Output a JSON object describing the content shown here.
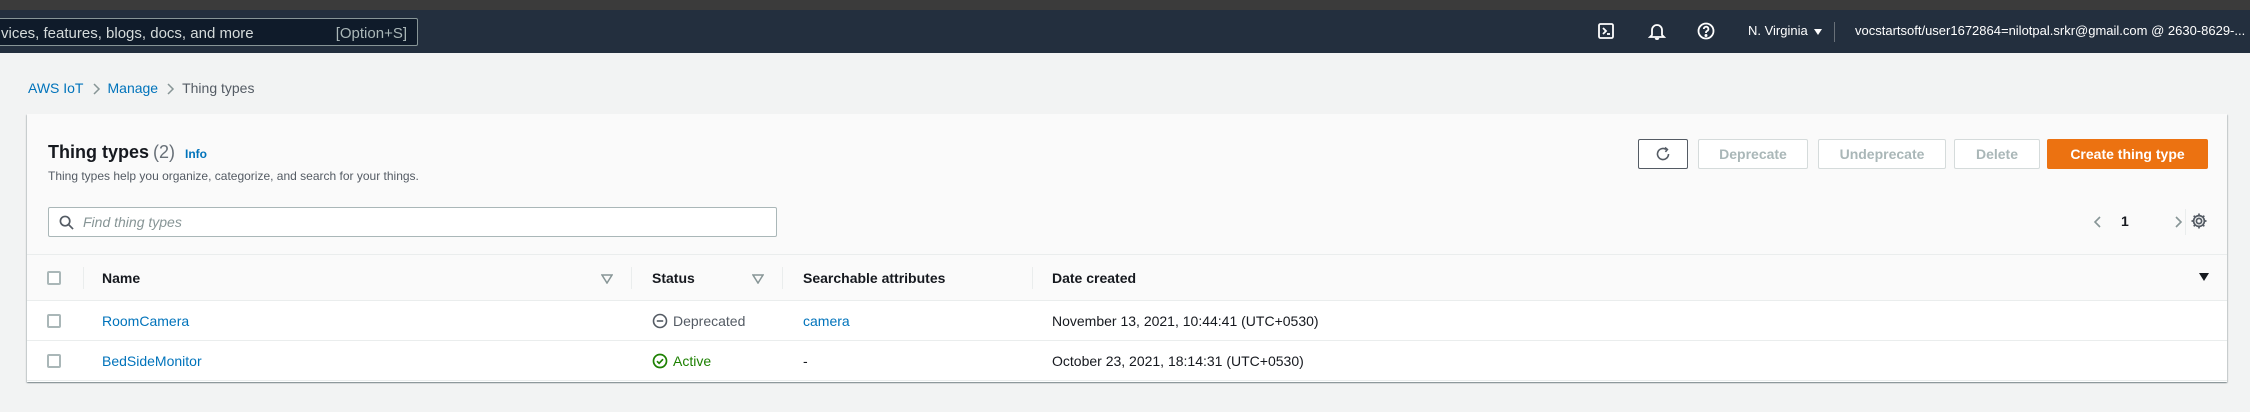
{
  "topbar": {
    "search_placeholder": "vices, features, blogs, docs, and more",
    "search_shortcut": "[Option+S]",
    "region": "N. Virginia",
    "account": "vocstartsoft/user1672864=nilotpal.srkr@gmail.com @ 2630-8629-...",
    "icons": [
      "cloudshell-icon",
      "notifications-icon",
      "help-icon"
    ]
  },
  "breadcrumb": {
    "items": [
      "AWS IoT",
      "Manage"
    ],
    "current": "Thing types"
  },
  "panel": {
    "title": "Thing types",
    "count": "(2)",
    "info": "Info",
    "description": "Thing types help you organize, categorize, and search for your things.",
    "buttons": {
      "deprecate": "Deprecate",
      "undeprecate": "Undeprecate",
      "delete": "Delete",
      "create": "Create thing type"
    },
    "filter_placeholder": "Find thing types",
    "page": "1"
  },
  "table": {
    "columns": [
      "Name",
      "Status",
      "Searchable attributes",
      "Date created"
    ],
    "rows": [
      {
        "name": "RoomCamera",
        "status": "Deprecated",
        "attributes": "camera",
        "date": "November 13, 2021, 10:44:41 (UTC+0530)"
      },
      {
        "name": "BedSideMonitor",
        "status": "Active",
        "attributes": "-",
        "date": "October 23, 2021, 18:14:31 (UTC+0530)"
      }
    ]
  },
  "colors": {
    "nav_bg": "#232f3e",
    "primary": "#ec7211",
    "link": "#0073bb",
    "success": "#1d8102",
    "page_bg": "#f2f3f3"
  }
}
